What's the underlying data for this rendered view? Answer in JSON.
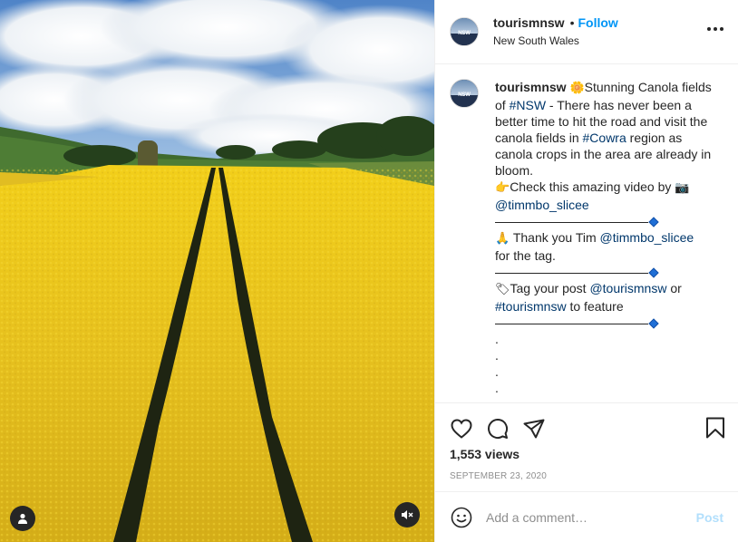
{
  "post": {
    "media": {
      "description_icons": {
        "user_tag": "user-tag-icon",
        "mute": "volume-muted-icon"
      }
    },
    "header": {
      "username": "tourismnsw",
      "separator": "•",
      "follow_label": "Follow",
      "location": "New South Wales",
      "avatar_text": "NSW"
    },
    "caption": {
      "username": "tourismnsw",
      "line1_emoji": "🌼",
      "line1_text": "Stunning Canola fields of ",
      "hashtag_nsw": "#NSW",
      "line1_rest": " - There has never been a better time to hit the road and visit the canola fields in ",
      "hashtag_cowra": "#Cowra",
      "line1_end": " region as canola crops in the area are already in bloom.",
      "check_emoji": "👉",
      "check_text": "Check this amazing video by ",
      "camera_emoji": "📷",
      "mention_timmbo": "@timmbo_slicee",
      "thanks_emoji": "🙏",
      "thanks_text": " Thank you Tim ",
      "mention_timmbo2": "@timmbo_slicee",
      "thanks_end": " for the tag.",
      "tag_emoji": "🏷",
      "tag_text": "Tag your post ",
      "mention_tourismnsw": "@tourismnsw",
      "tag_or": " or",
      "hashtag_tourismnsw": "#tourismnsw",
      "tag_end": " to feature",
      "dot": "."
    },
    "actions": {
      "like_icon": "heart-icon",
      "comment_icon": "comment-icon",
      "share_icon": "share-icon",
      "save_icon": "bookmark-icon"
    },
    "views": "1,553 views",
    "date": "September 23, 2020",
    "composer": {
      "placeholder": "Add a comment…",
      "post_label": "Post"
    }
  },
  "colors": {
    "accent": "#0095f6",
    "post_disabled": "#b2dffc",
    "link": "#00376b",
    "canola": "#e9c52a"
  }
}
